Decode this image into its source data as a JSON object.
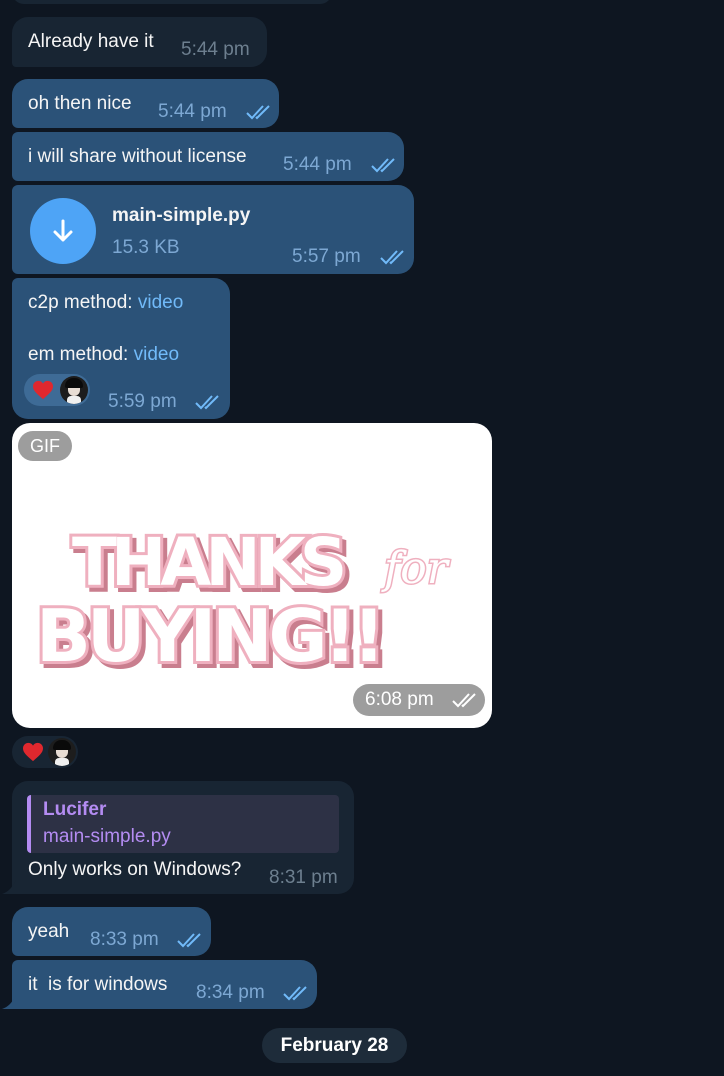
{
  "messages": {
    "m1": {
      "text": "Already have it",
      "time": "5:44 pm"
    },
    "m2": {
      "text": "oh then nice",
      "time": "5:44 pm"
    },
    "m3": {
      "text": "i will share without license",
      "time": "5:44 pm"
    },
    "m4": {
      "file_name": "main-simple.py",
      "file_size": "15.3 KB",
      "time": "5:57 pm"
    },
    "m5": {
      "line1_label": "c2p method: ",
      "line1_link": "video",
      "line2_label": "em method: ",
      "line2_link": "video",
      "time": "5:59 pm",
      "reaction": "heart"
    },
    "m6": {
      "badge": "GIF",
      "line1": "THANKS",
      "script": "for",
      "line2": "BUYING!!",
      "time": "6:08 pm",
      "reaction": "heart"
    },
    "m7": {
      "reply_author": "Lucifer",
      "reply_text": "main-simple.py",
      "text": "Only works on Windows?",
      "time": "8:31 pm"
    },
    "m8": {
      "text": "yeah",
      "time": "8:33 pm"
    },
    "m9": {
      "text": "it  is for windows",
      "time": "8:34 pm"
    }
  },
  "date_separator": "February 28",
  "colors": {
    "background": "#0e1621",
    "incoming_bubble": "#182533",
    "outgoing_bubble": "#2b5278",
    "link": "#71baf9",
    "reply_author": "#b48cf2",
    "heart": "#e0282e"
  },
  "icons": [
    "double-check-icon",
    "download-arrow-icon",
    "heart-icon",
    "avatar"
  ]
}
